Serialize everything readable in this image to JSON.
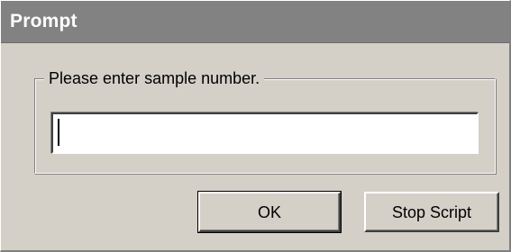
{
  "window": {
    "title": "Prompt"
  },
  "prompt": {
    "group_label": "Please enter sample number.",
    "input_value": "",
    "input_placeholder": ""
  },
  "buttons": {
    "ok_label": "OK",
    "stop_label": "Stop Script"
  },
  "colors": {
    "title_bar": "#828282",
    "dialog_face": "#d4d0c8",
    "input_background": "#ffffff"
  }
}
